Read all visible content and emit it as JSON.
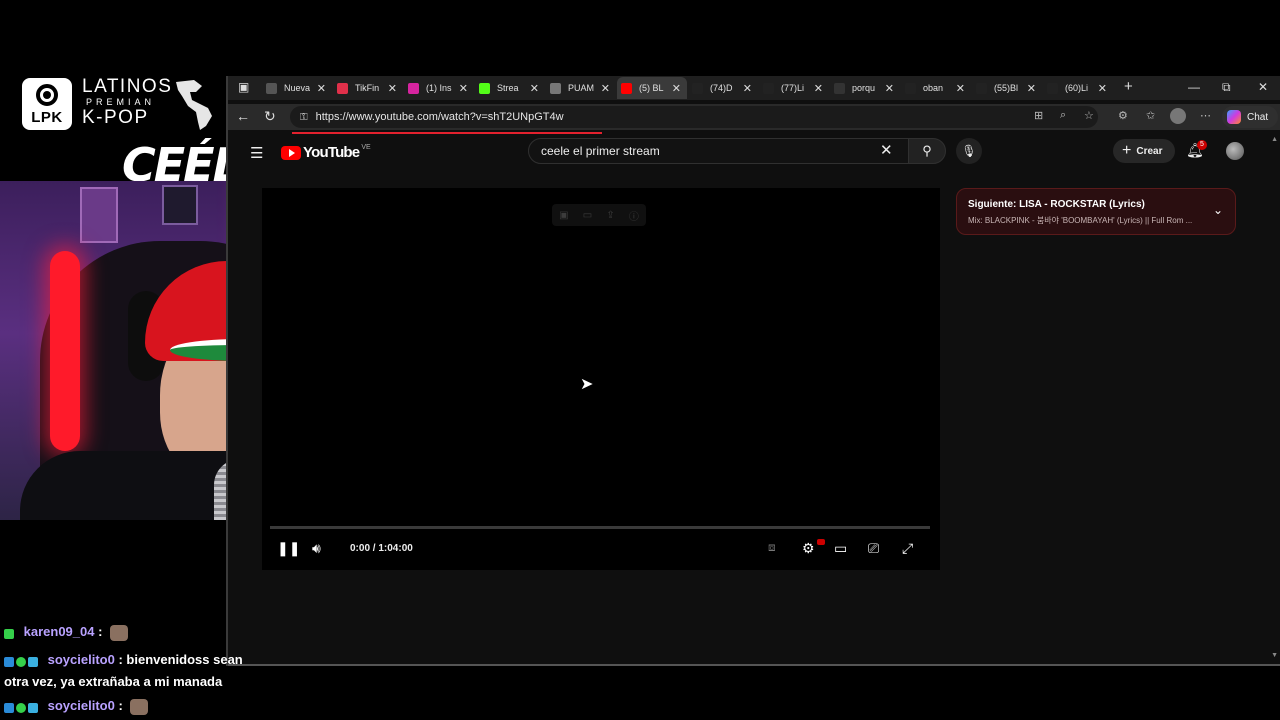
{
  "overlay": {
    "logo": {
      "abbr": "LPK",
      "line1": "LATINOS",
      "line2": "PREMIAN",
      "line3": "K-POP"
    },
    "streamer_name": "CEÉLE"
  },
  "browser": {
    "tabs": [
      {
        "label": "Nueva",
        "favicon": "page-icon"
      },
      {
        "label": "TikFin",
        "favicon": "tikfinity-icon"
      },
      {
        "label": "(1) Ins",
        "favicon": "instagram-icon"
      },
      {
        "label": "Strea",
        "favicon": "kick-icon"
      },
      {
        "label": "PUAM",
        "favicon": "globe-icon"
      },
      {
        "label": "(5) BL",
        "favicon": "youtube-icon",
        "active": true
      },
      {
        "label": "(74)D",
        "favicon": "tiktok-icon"
      },
      {
        "label": "(77)Li",
        "favicon": "tiktok-icon"
      },
      {
        "label": "porqu",
        "favicon": "search-icon"
      },
      {
        "label": "oban",
        "favicon": "tiktok-icon"
      },
      {
        "label": "(55)Bl",
        "favicon": "tiktok-icon"
      },
      {
        "label": "(60)Li",
        "favicon": "tiktok-icon"
      }
    ],
    "url": "https://www.youtube.com/watch?v=shT2UNpGT4w",
    "chat_label": "Chat"
  },
  "youtube": {
    "logo_text": "YouTube",
    "country_code": "VE",
    "search_query": "ceele el primer stream",
    "create_label": "Crear",
    "notification_count": "5",
    "player": {
      "time": "0:00 / 1:04:00",
      "progress": 0
    },
    "playlist": {
      "title": "Siguiente: LISA - ROCKSTAR (Lyrics)",
      "subtitle": "Mix: BLACKPINK - 붐바야 'BOOMBAYAH' (Lyrics) || Full Rom ..."
    }
  },
  "chat": [
    {
      "user": "karen09_04",
      "sep": ":",
      "text": ""
    },
    {
      "user": "soycielito0",
      "sep": ":",
      "text": "bienvenidoss sean",
      "cont": "otra vez, ya extrañaba a mi manada"
    },
    {
      "user": "soycielito0",
      "sep": ":",
      "text": ""
    }
  ],
  "colors": {
    "accent_red": "#ff0000",
    "chat_username": "#b9a2ff",
    "playlist_bg": "#2a0e10"
  }
}
